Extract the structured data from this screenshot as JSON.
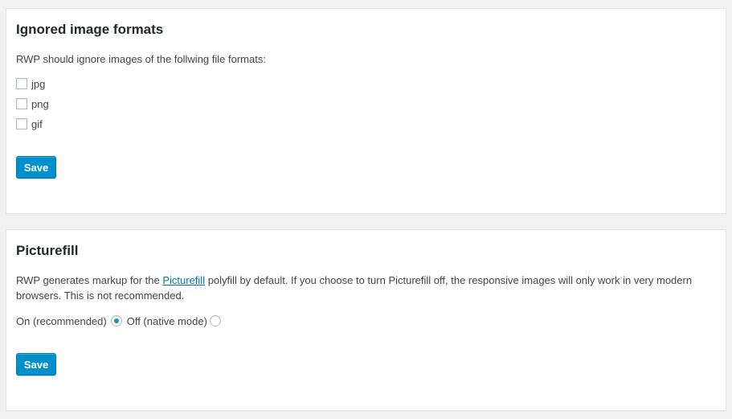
{
  "ignored_formats": {
    "title": "Ignored image formats",
    "description": "RWP should ignore images of the follwing file formats:",
    "formats": [
      {
        "label": "jpg",
        "checked": false
      },
      {
        "label": "png",
        "checked": false
      },
      {
        "label": "gif",
        "checked": false
      }
    ],
    "save_label": "Save"
  },
  "picturefill": {
    "title": "Picturefill",
    "description_before": "RWP generates markup for the ",
    "link_text": "Picturefill",
    "description_after": " polyfill by default. If you choose to turn Picturefill off, the responsive images will only work in very modern browsers. This is not recommended.",
    "option_on": "On (recommended)",
    "option_off": "Off (native mode)",
    "selected": "on",
    "save_label": "Save"
  },
  "colors": {
    "primary_button": "#0091cd",
    "link": "#0073aa",
    "radio_dot": "#1e8cbe"
  }
}
